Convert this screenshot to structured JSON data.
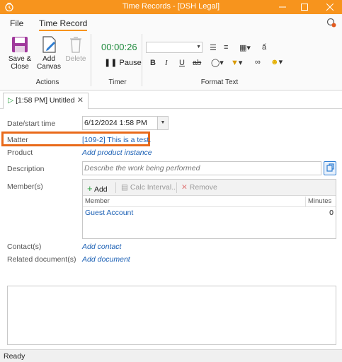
{
  "window": {
    "title": "Time Records - [DSH Legal]",
    "accent_color": "#f7941d"
  },
  "menu": {
    "file": "File",
    "time_record": "Time Record"
  },
  "ribbon": {
    "actions": {
      "save_close_line1": "Save &",
      "save_close_line2": "Close",
      "add_canvas_line1": "Add",
      "add_canvas_line2": "Canvas",
      "delete": "Delete",
      "group_label": "Actions"
    },
    "timer": {
      "elapsed": "00:00:26",
      "pause": "Pause",
      "group_label": "Timer"
    },
    "format_text": {
      "bold": "B",
      "italic": "I",
      "underline": "U",
      "strike": "ab",
      "group_label": "Format Text"
    }
  },
  "doc_tab": {
    "label": "[1:58 PM] Untitled"
  },
  "form": {
    "date_label": "Date/start time",
    "date_value": "6/12/2024 1:58 PM",
    "matter_label": "Matter",
    "matter_value": "[109-2] This is a test.",
    "product_label": "Product",
    "product_link": "Add product instance",
    "description_label": "Description",
    "description_placeholder": "Describe the work being performed",
    "members_label": "Member(s)",
    "contacts_label": "Contact(s)",
    "contacts_link": "Add contact",
    "related_docs_label": "Related document(s)",
    "related_docs_link": "Add document",
    "highlight_color": "#e96a1a"
  },
  "members": {
    "add": "Add",
    "calc_interval": "Calc Interval...",
    "remove": "Remove",
    "columns": [
      "Member",
      "Minutes"
    ],
    "rows": [
      {
        "member": "Guest Account",
        "minutes": "0"
      }
    ]
  },
  "status": {
    "text": "Ready"
  }
}
